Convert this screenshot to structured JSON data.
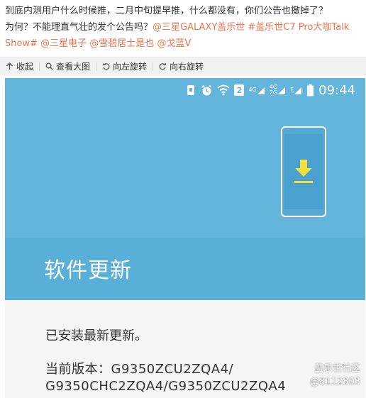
{
  "post": {
    "line1": "到底内测用户什么时候推，二月中旬提早推，什么都没有，你们公告也撤掉了？",
    "line2_prefix": "为何？不能理直气壮的发个公告吗？",
    "mention1": "@三星GALAXY盖乐世",
    "topic": "#盖乐世C7 Pro大咖Talk Show#",
    "mention2": "@三星电子",
    "mention3": "@雪碧居士是也",
    "mention4": "@戈蓝V"
  },
  "toolbar": {
    "collapse": "收起",
    "view_large": "查看大图",
    "rotate_left": "向左旋转",
    "rotate_right": "向右旋转"
  },
  "phone": {
    "status_bar": {
      "sim_label": "2",
      "net_4g_top": "4G",
      "net_4g": "4G",
      "net_2g": "2G",
      "net_e": "E",
      "time": "09:44"
    },
    "screen_title": "软件更新",
    "status_text": "已安装最新更新。",
    "version_line1": "当前版本：G9350ZCU2ZQA4/",
    "version_line2": "G9350CHC2ZQA4/G9350ZCU2ZQA4"
  },
  "watermark": {
    "name": "盖乐世社区",
    "id": "@8112803"
  },
  "colors": {
    "mention": "#eb7350",
    "hero_blue": "#64b5db",
    "download_yellow": "#f1e03a"
  }
}
